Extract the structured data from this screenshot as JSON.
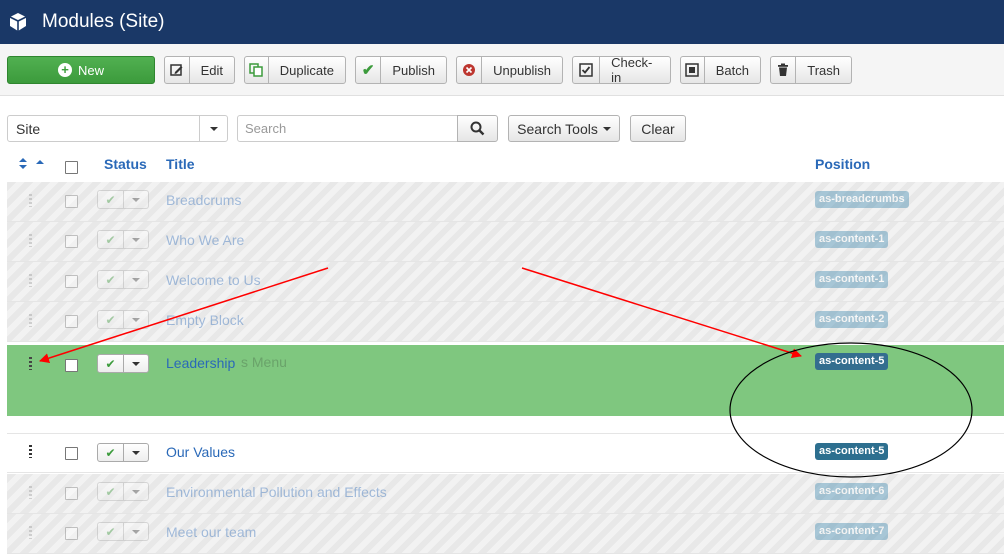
{
  "header": {
    "title": "Modules (Site)",
    "icon": "cube-icon"
  },
  "toolbar": {
    "new": "New",
    "edit": "Edit",
    "duplicate": "Duplicate",
    "publish": "Publish",
    "unpublish": "Unpublish",
    "checkin": "Check-in",
    "batch": "Batch",
    "trash": "Trash"
  },
  "filters": {
    "client": "Site",
    "search_placeholder": "Search",
    "search_tools": "Search Tools",
    "clear": "Clear"
  },
  "table": {
    "columns": {
      "status": "Status",
      "title": "Title",
      "position": "Position"
    },
    "rows": [
      {
        "title": "Breadcrums",
        "position": "as-breadcrumbs",
        "state": "faded"
      },
      {
        "title": "Who We Are",
        "position": "as-content-1",
        "state": "faded"
      },
      {
        "title": "Welcome to Us",
        "position": "as-content-1",
        "state": "faded"
      },
      {
        "title": "Empty Block",
        "position": "as-content-2",
        "state": "faded"
      },
      {
        "title": "Leadership",
        "position": "as-content-5",
        "state": "dragging",
        "ghost_text": "s Menu"
      },
      {
        "title": "Our Values",
        "position": "as-content-5",
        "state": "normal"
      },
      {
        "title": "Environmental Pollution and Effects",
        "position": "as-content-6",
        "state": "faded"
      },
      {
        "title": "Meet our team",
        "position": "as-content-7",
        "state": "faded"
      }
    ]
  },
  "colors": {
    "header": "#1a3867",
    "new_button": "#46a546",
    "link": "#2a69b8",
    "badge": "#3a87ad",
    "drag_row": "#7fc77f",
    "annotation_arrow": "#ff0000"
  }
}
